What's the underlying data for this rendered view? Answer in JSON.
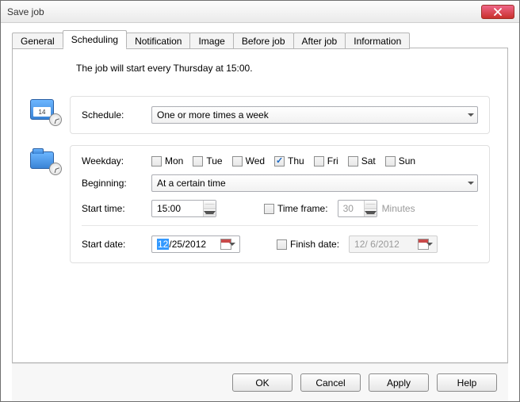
{
  "window": {
    "title": "Save job"
  },
  "tabs": [
    {
      "label": "General"
    },
    {
      "label": "Scheduling"
    },
    {
      "label": "Notification"
    },
    {
      "label": "Image"
    },
    {
      "label": "Before job"
    },
    {
      "label": "After job"
    },
    {
      "label": "Information"
    }
  ],
  "summary": "The job will start every Thursday at 15:00.",
  "calendar_day": "14",
  "schedule": {
    "label": "Schedule:",
    "value": "One or more times a week"
  },
  "weekday": {
    "label": "Weekday:",
    "days": [
      {
        "label": "Mon",
        "checked": false
      },
      {
        "label": "Tue",
        "checked": false
      },
      {
        "label": "Wed",
        "checked": false
      },
      {
        "label": "Thu",
        "checked": true
      },
      {
        "label": "Fri",
        "checked": false
      },
      {
        "label": "Sat",
        "checked": false
      },
      {
        "label": "Sun",
        "checked": false
      }
    ]
  },
  "beginning": {
    "label": "Beginning:",
    "value": "At a certain time"
  },
  "start_time": {
    "label": "Start time:",
    "value": "15:00"
  },
  "time_frame": {
    "label": "Time frame:",
    "value": "30",
    "unit": "Minutes",
    "checked": false
  },
  "start_date": {
    "label": "Start date:",
    "sel": "12",
    "rest": "/25/2012"
  },
  "finish_date": {
    "label": "Finish date:",
    "value": "12/ 6/2012",
    "checked": false
  },
  "buttons": {
    "ok": "OK",
    "cancel": "Cancel",
    "apply": "Apply",
    "help": "Help"
  }
}
